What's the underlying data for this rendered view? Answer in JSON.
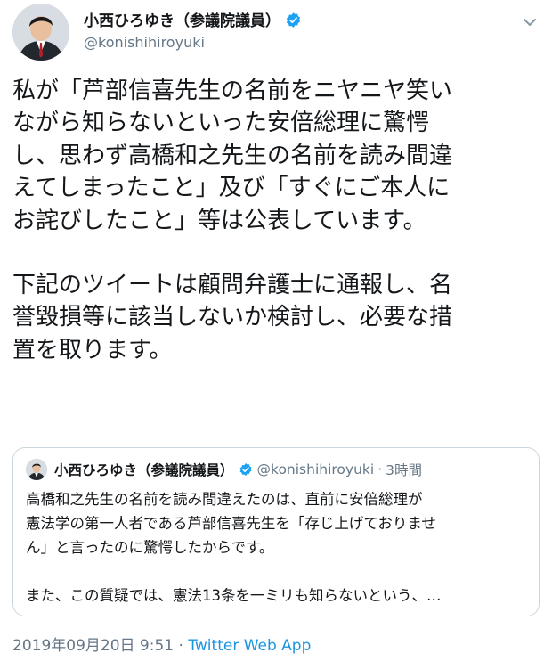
{
  "author": {
    "display_name": "小西ひろゆき（参議院議員）",
    "handle": "@konishihiroyuki",
    "verified": true
  },
  "tweet": {
    "paragraphs": [
      "私が「芦部信喜先生の名前をニヤニヤ笑い\nながら知らないといった安倍総理に驚愕\nし、思わず高橋和之先生の名前を読み間違\nえてしまったこと」及び「すぐにご本人に\nお詫びしたこと」等は公表しています。",
      "下記のツイートは顧問弁護士に通報し、名\n誉毀損等に該当しないか検討し、必要な措\n置を取ります。"
    ]
  },
  "quoted_tweet": {
    "display_name": "小西ひろゆき（参議院議員）",
    "handle": "@konishihiroyuki",
    "separator": "·",
    "time": "3時間",
    "verified": true,
    "paragraphs": [
      "高橋和之先生の名前を読み間違えたのは、直前に安倍総理が\n憲法学の第一人者である芦部信喜先生を「存じ上げておりませ\nん」と言ったのに驚愕したからです。",
      "また、この質疑では、憲法13条を一ミリも知らないという、…"
    ]
  },
  "metadata": {
    "timestamp": "2019年09月20日 9:51",
    "separator": "·",
    "source": "Twitter Web App"
  },
  "colors": {
    "verified_badge": "#1da1f2",
    "link_blue": "#1b95e0",
    "secondary_text": "#657786"
  },
  "icons": [
    "verified-badge-icon",
    "chevron-down-icon"
  ]
}
